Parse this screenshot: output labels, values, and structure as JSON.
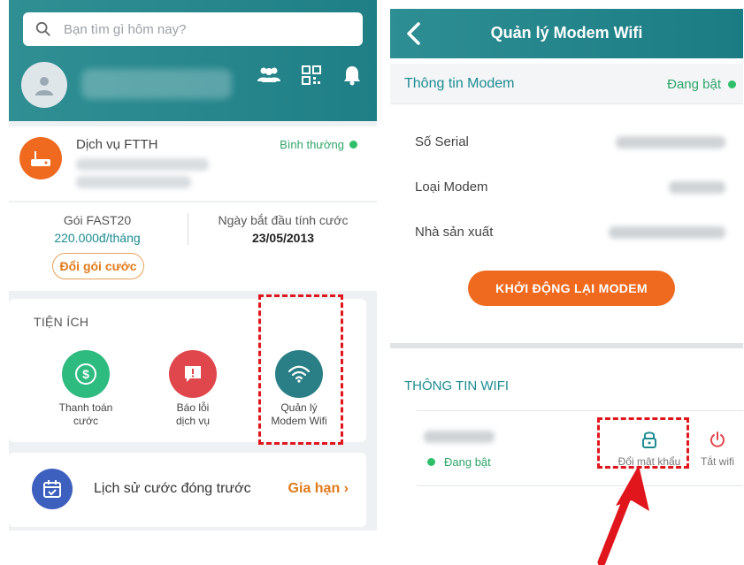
{
  "left": {
    "search": {
      "placeholder": "Bạn tìm gì hôm nay?"
    },
    "service": {
      "title": "Dịch vụ FTTH",
      "status": "Bình thường"
    },
    "package": {
      "name": "Gói FAST20",
      "price": "220.000đ/tháng",
      "change_button": "Đổi gói cước",
      "date_label": "Ngày bắt đầu tính cước",
      "date_value": "23/05/2013"
    },
    "utilities": {
      "title": "TIỆN ÍCH",
      "items": [
        {
          "line1": "Thanh toán",
          "line2": "cước",
          "color": "#2dbb7f",
          "icon": "dollar-icon"
        },
        {
          "line1": "Báo lỗi",
          "line2": "dịch vụ",
          "color": "#e0474c",
          "icon": "report-icon"
        },
        {
          "line1": "Quản lý",
          "line2": "Modem Wifi",
          "color": "#2a7f86",
          "icon": "wifi-icon"
        }
      ]
    },
    "history": {
      "label": "Lịch sử cước đóng trước",
      "link": "Gia hạn ›"
    },
    "colors": {
      "header": "#1f7f86",
      "accent": "#ef6a1f",
      "highlight": "#e0161c"
    }
  },
  "right": {
    "header": {
      "title": "Quản lý Modem Wifi"
    },
    "modem_section": {
      "title": "Thông tin Modem",
      "status": "Đang bật"
    },
    "rows": [
      {
        "label": "Số Serial"
      },
      {
        "label": "Loại Modem"
      },
      {
        "label": "Nhà sản xuất"
      }
    ],
    "restart_button": "KHỞI ĐỘNG LẠI MODEM",
    "wifi_section": {
      "title": "THÔNG TIN WIFI"
    },
    "wifi": {
      "status": "Đang bật",
      "change_password": "Đổi mật khẩu",
      "turn_off": "Tắt wifi"
    }
  }
}
